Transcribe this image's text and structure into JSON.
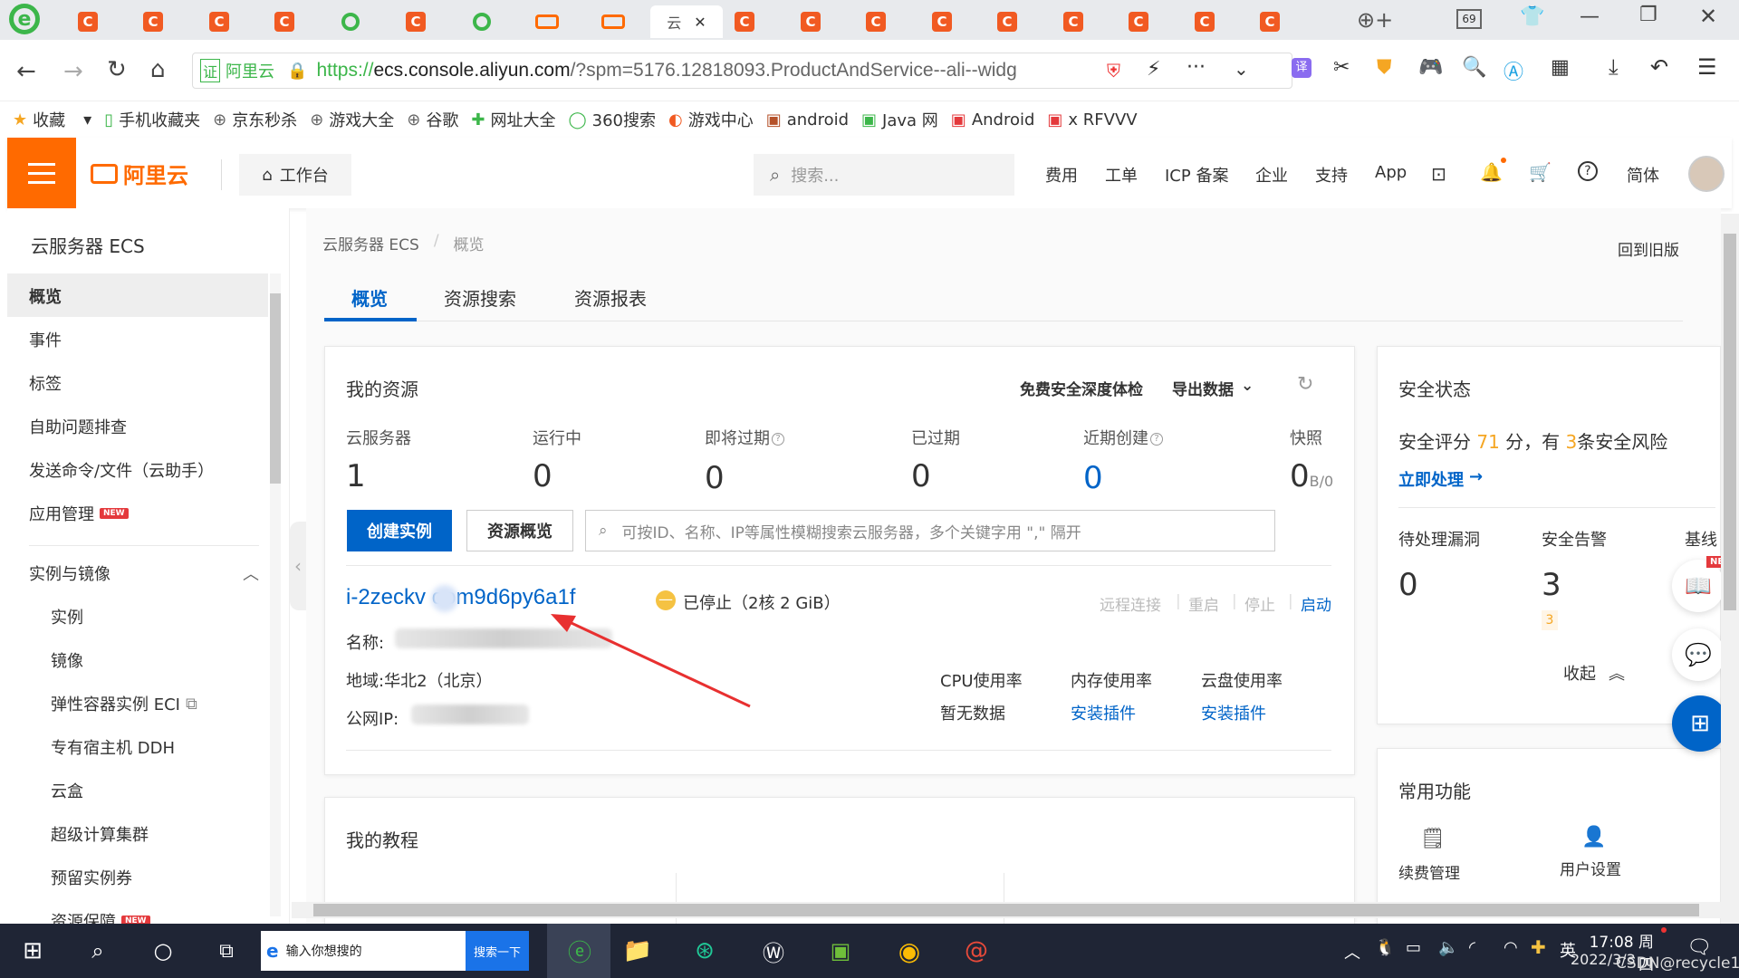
{
  "browser": {
    "tabs": [
      {
        "icon": "c-icon"
      },
      {
        "icon": "c-icon"
      },
      {
        "icon": "c-icon"
      },
      {
        "icon": "c-icon"
      },
      {
        "icon": "360-icon"
      },
      {
        "icon": "c-icon"
      },
      {
        "icon": "360-icon"
      },
      {
        "icon": "aliyun-icon"
      },
      {
        "icon": "aliyun-icon"
      },
      {
        "icon": "page-icon",
        "label": "云",
        "active": true
      },
      {
        "icon": "c-icon"
      },
      {
        "icon": "c-icon"
      },
      {
        "icon": "c-icon"
      },
      {
        "icon": "c-icon"
      },
      {
        "icon": "c-icon"
      },
      {
        "icon": "c-icon"
      },
      {
        "icon": "c-icon"
      },
      {
        "icon": "c-icon"
      },
      {
        "icon": "c-icon"
      }
    ],
    "tab_count": "69",
    "url_badge": "阿里云",
    "url_scheme": "https://",
    "url_host": "ecs.console.aliyun.com",
    "url_path": "/?spm=5176.12818093.ProductAndService--ali--widg",
    "bookmarks": [
      "收藏",
      "手机收藏夹",
      "京东秒杀",
      "游戏大全",
      "谷歌",
      "网址大全",
      "360搜索",
      "游戏中心",
      "android",
      "Java 网",
      "Android",
      "x RFVVV"
    ]
  },
  "header": {
    "logo": "阿里云",
    "workbench": "工作台",
    "search_placeholder": "搜索...",
    "nav": [
      "费用",
      "工单",
      "ICP 备案",
      "企业",
      "支持",
      "App"
    ],
    "lang": "简体"
  },
  "sidebar": {
    "title": "云服务器 ECS",
    "items": [
      {
        "label": "概览",
        "active": true
      },
      {
        "label": "事件"
      },
      {
        "label": "标签"
      },
      {
        "label": "自助问题排查"
      },
      {
        "label": "发送命令/文件（云助手）"
      },
      {
        "label": "应用管理",
        "badge": "NEW"
      }
    ],
    "group": "实例与镜像",
    "sub_items": [
      {
        "label": "实例"
      },
      {
        "label": "镜像"
      },
      {
        "label": "弹性容器实例 ECI"
      },
      {
        "label": "专有宿主机 DDH"
      },
      {
        "label": "云盒"
      },
      {
        "label": "超级计算集群"
      },
      {
        "label": "预留实例券"
      },
      {
        "label": "资源保障",
        "badge": "NEW"
      }
    ]
  },
  "main": {
    "breadcrumb": [
      "云服务器 ECS",
      "概览"
    ],
    "back_old": "回到旧版",
    "tabs": [
      "概览",
      "资源搜索",
      "资源报表"
    ],
    "resources": {
      "title": "我的资源",
      "security_check": "免费安全深度体检",
      "export": "导出数据",
      "stats": [
        {
          "label": "云服务器",
          "value": "1"
        },
        {
          "label": "运行中",
          "value": "0"
        },
        {
          "label": "即将过期",
          "value": "0"
        },
        {
          "label": "已过期",
          "value": "0"
        },
        {
          "label": "近期创建",
          "value": "0"
        },
        {
          "label": "快照",
          "value": "0",
          "unit": "B/0"
        }
      ],
      "create_btn": "创建实例",
      "overview_btn": "资源概览",
      "search_placeholder": "可按ID、名称、IP等属性模糊搜索云服务器，多个关键字用 \",\" 隔开",
      "instance": {
        "id": "i-2zeckv  oom9d6py6a1f",
        "status": "已停止",
        "spec": "（2核 2 GiB）",
        "actions": [
          "远程连接",
          "重启",
          "停止",
          "启动"
        ],
        "name_label": "名称:",
        "region_label": "地域:",
        "region": "华北2（北京）",
        "ip_label": "公网IP:",
        "cpu_label": "CPU使用率",
        "cpu_value": "暂无数据",
        "mem_label": "内存使用率",
        "mem_value": "安装插件",
        "disk_label": "云盘使用率",
        "disk_value": "安装插件"
      }
    },
    "tutorials_title": "我的教程"
  },
  "security": {
    "title": "安全状态",
    "score_prefix": "安全评分",
    "score": "71",
    "score_mid": "分，有",
    "risk_count": "3",
    "score_suffix": "条安全风险",
    "action": "立即处理",
    "vuln_label": "待处理漏洞",
    "vuln_value": "0",
    "alert_label": "安全告警",
    "alert_value": "3",
    "alert_sub": "3",
    "baseline_label": "基线",
    "collapse": "收起"
  },
  "common": {
    "title": "常用功能",
    "items": [
      "续费管理",
      "用户设置"
    ]
  },
  "taskbar": {
    "search": "输入你想搜的",
    "search_btn": "搜索一下",
    "ime": "英",
    "time": "17:08 周四",
    "date": "2022/3/3",
    "overlay": "CSDN@recycle1"
  }
}
